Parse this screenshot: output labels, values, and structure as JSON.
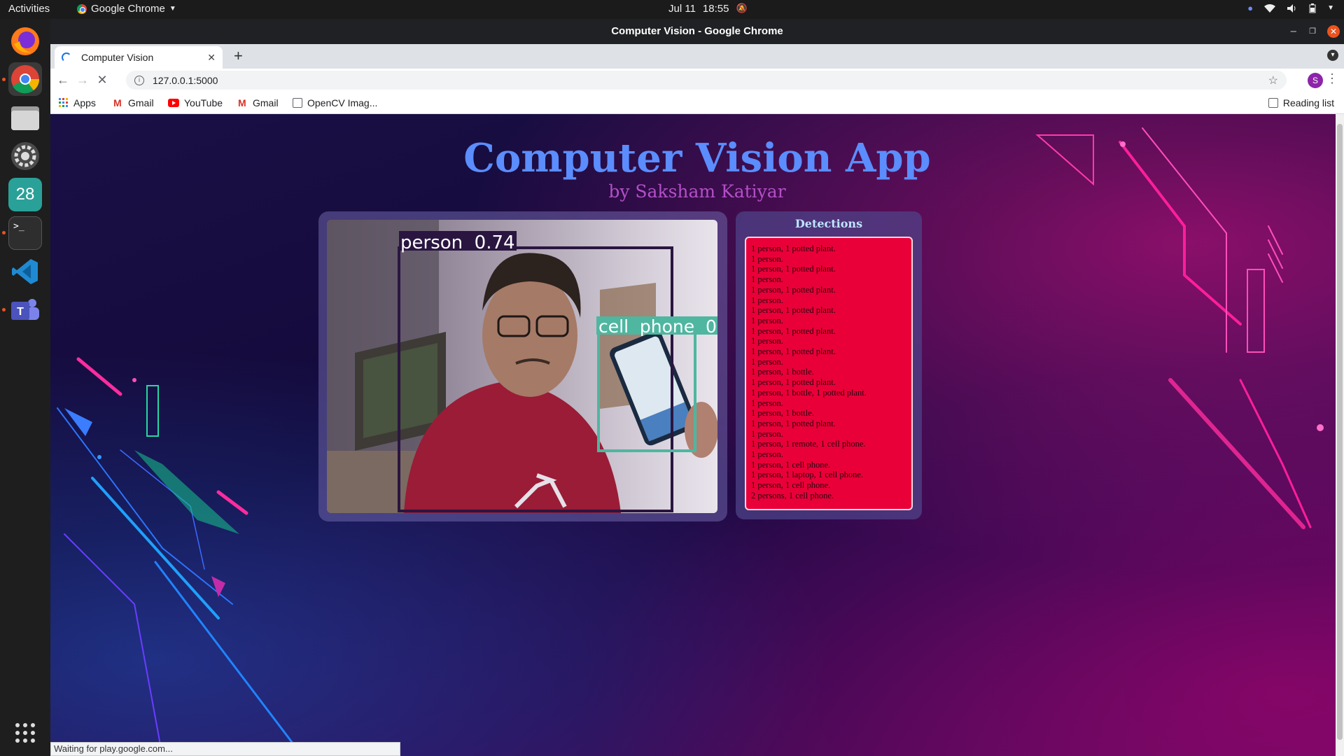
{
  "topbar": {
    "activities": "Activities",
    "app_name": "Google Chrome",
    "date": "Jul 11",
    "time": "18:55"
  },
  "dock": {
    "calendar_day": "28",
    "terminal_prompt": ">_",
    "teams_letter": "T"
  },
  "window": {
    "title": "Computer Vision - Google Chrome"
  },
  "tabs": [
    {
      "title": "Computer Vision"
    }
  ],
  "omnibox": {
    "url": "127.0.0.1:5000"
  },
  "profile_initial": "S",
  "bookmarks": {
    "items": [
      "Apps",
      "Gmail",
      "YouTube",
      "Gmail",
      "OpenCV Imag..."
    ],
    "reading_list": "Reading list"
  },
  "page": {
    "title": "Computer Vision App",
    "subtitle": "by Saksham Katiyar",
    "detections_title": "Detections",
    "labels": {
      "person": "person  0.74",
      "phone": "cell  phone  0"
    },
    "detections": [
      "1 person, 1 potted plant.",
      "1 person.",
      "1 person, 1 potted plant.",
      "1 person.",
      "1 person, 1 potted plant.",
      "1 person.",
      "1 person, 1 potted plant.",
      "1 person.",
      "1 person, 1 potted plant.",
      "1 person.",
      "1 person, 1 potted plant.",
      "1 person.",
      "1 person, 1 bottle.",
      "1 person, 1 potted plant.",
      "1 person, 1 bottle, 1 potted plant.",
      "1 person.",
      "1 person, 1 bottle.",
      "1 person, 1 potted plant.",
      "1 person.",
      "1 person, 1 remote, 1 cell phone.",
      "1 person.",
      "1 person, 1 cell phone.",
      "1 person, 1 laptop, 1 cell phone.",
      "1 person, 1 cell phone.",
      "2 persons, 1 cell phone."
    ]
  },
  "status_text": "Waiting for play.google.com...",
  "colors": {
    "title": "#5b8dff",
    "subtitle": "#b44fc8",
    "detections_bg": "#ea0038",
    "person_box": "#2a1540",
    "phone_box": "#4fb6a0"
  }
}
